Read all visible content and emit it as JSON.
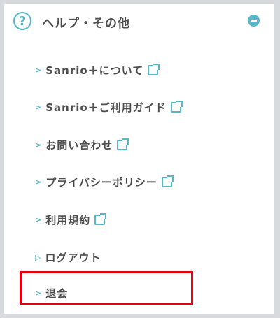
{
  "header": {
    "title": "ヘルプ・その他",
    "help_icon": "?"
  },
  "items": [
    {
      "label": "Sanrio＋について"
    },
    {
      "label": "Sanrio＋ご利用ガイド"
    },
    {
      "label": "お問い合わせ"
    },
    {
      "label": "プライバシーポリシー"
    },
    {
      "label": "利用規約"
    },
    {
      "label": "ログアウト"
    },
    {
      "label": "退会"
    }
  ],
  "colors": {
    "accent": "#56b7c9",
    "highlight": "#e50012",
    "text": "#4d4d4d"
  }
}
